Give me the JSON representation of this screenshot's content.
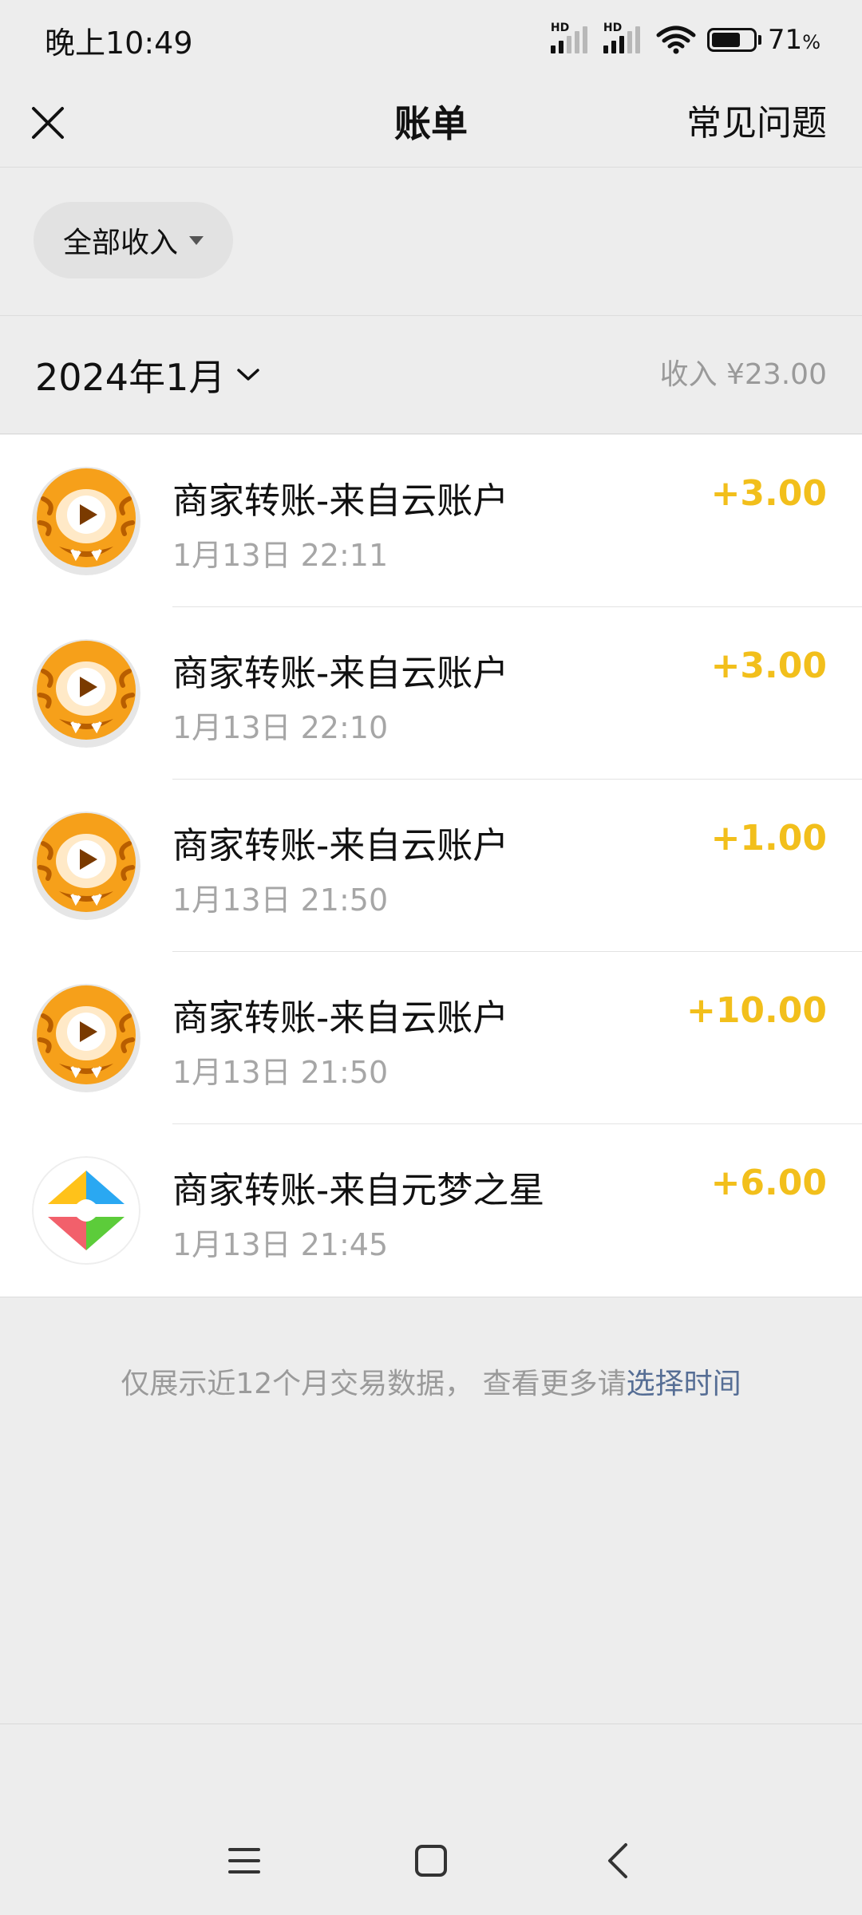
{
  "status_bar": {
    "time": "晚上10:49",
    "hd1": "HD",
    "hd2": "HD",
    "battery_percent": "71",
    "percent_sign": "%"
  },
  "nav": {
    "title": "账单",
    "faq": "常见问题"
  },
  "filter": {
    "label": "全部收入"
  },
  "month": {
    "label": "2024年1月",
    "income": "收入 ¥23.00"
  },
  "transactions": [
    {
      "title": "商家转账-来自云账户",
      "time": "1月13日 22:11",
      "amount": "+3.00",
      "icon": "tiger-video-icon"
    },
    {
      "title": "商家转账-来自云账户",
      "time": "1月13日 22:10",
      "amount": "+3.00",
      "icon": "tiger-video-icon"
    },
    {
      "title": "商家转账-来自云账户",
      "time": "1月13日 21:50",
      "amount": "+1.00",
      "icon": "tiger-video-icon"
    },
    {
      "title": "商家转账-来自云账户",
      "time": "1月13日 21:50",
      "amount": "+10.00",
      "icon": "tiger-video-icon"
    },
    {
      "title": "商家转账-来自元梦之星",
      "time": "1月13日 21:45",
      "amount": "+6.00",
      "icon": "colorful-diamond-icon"
    }
  ],
  "footer": {
    "note": "仅展示近12个月交易数据，",
    "note2": "查看更多请",
    "link": "选择时间"
  },
  "colors": {
    "amount": "#f2bf1b",
    "link": "#566e95",
    "background": "#ededed"
  }
}
